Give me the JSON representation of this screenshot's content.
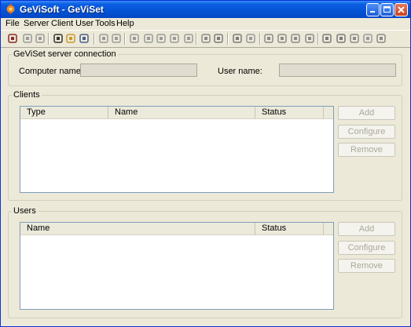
{
  "window": {
    "title": "GeViSoft - GeViSet"
  },
  "titlebar_buttons": {
    "minimize": "minimize-icon",
    "maximize": "maximize-icon",
    "close": "close-icon"
  },
  "menu": [
    "File",
    "Server",
    "Client",
    "User",
    "Tools",
    "Help"
  ],
  "toolbar": {
    "icons": [
      "connect-icon",
      "copy-icon",
      "settings-icon",
      "new-icon",
      "open-icon",
      "save-icon",
      "quote-icon",
      "clock-icon",
      "tools-icon",
      "list-icon",
      "print-icon",
      "stack-icon",
      "text-icon",
      "user-icon",
      "record-icon",
      "pen-icon",
      "hand-icon",
      "network-icon",
      "grid-icon",
      "relay-icon",
      "monitor-icon",
      "filter-icon",
      "block-icon",
      "device-icon",
      "dialog-icon",
      "arrow-icon"
    ]
  },
  "server_connection": {
    "title": "GeViSet server connection",
    "computer_name_label": "Computer name:",
    "computer_name_value": "",
    "user_name_label": "User name:",
    "user_name_value": ""
  },
  "clients": {
    "title": "Clients",
    "columns": [
      "Type",
      "Name",
      "Status"
    ],
    "rows": [],
    "add_label": "Add",
    "configure_label": "Configure",
    "remove_label": "Remove"
  },
  "users": {
    "title": "Users",
    "columns": [
      "Name",
      "Status"
    ],
    "rows": [],
    "add_label": "Add",
    "configure_label": "Configure",
    "remove_label": "Remove"
  }
}
